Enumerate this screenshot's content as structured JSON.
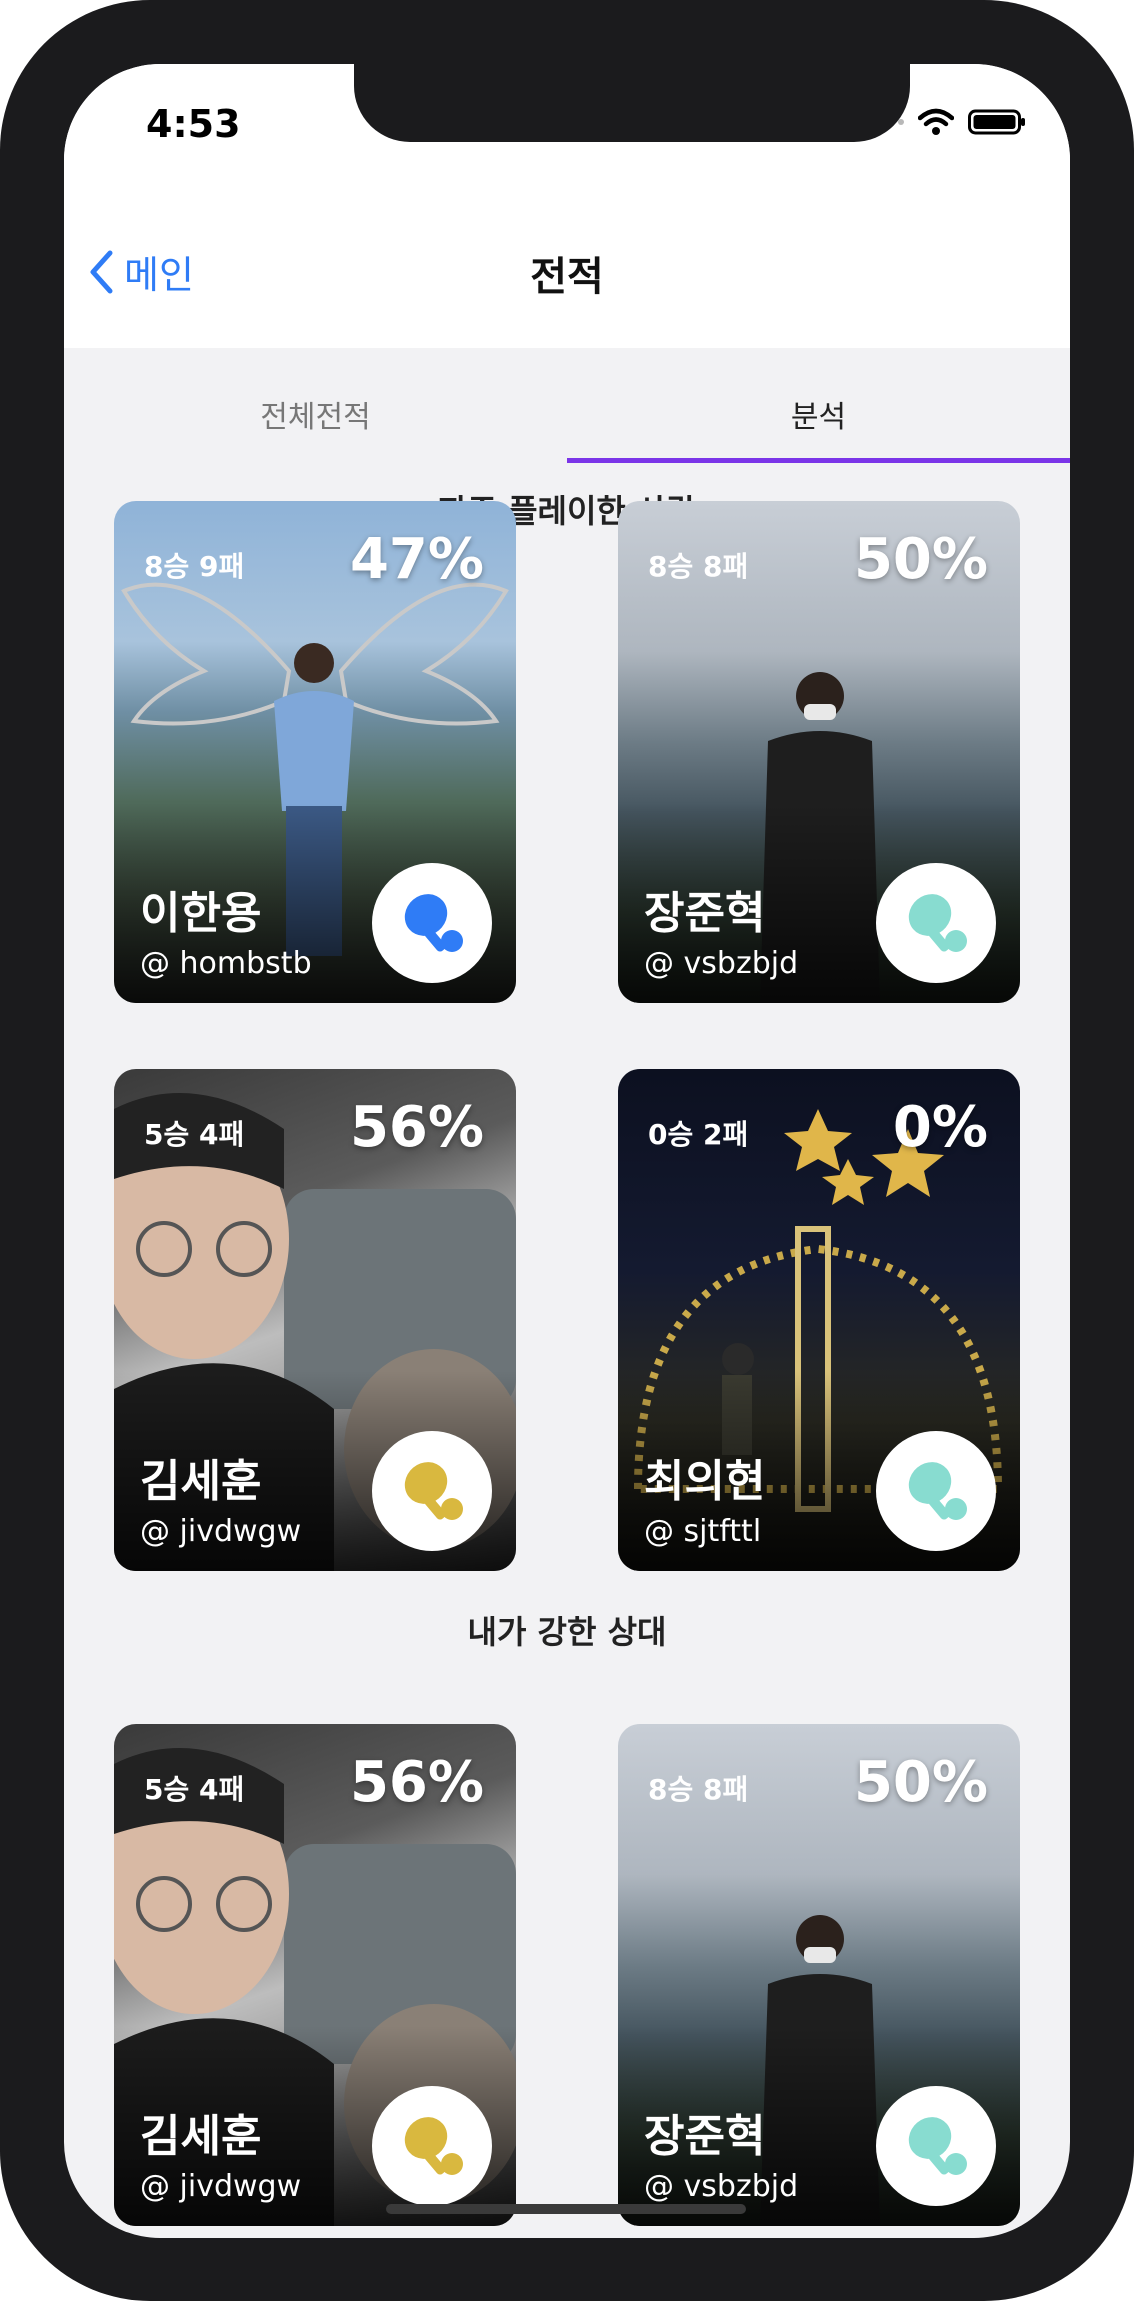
{
  "status": {
    "time": "4:53"
  },
  "nav": {
    "back_label": "메인",
    "title": "전적"
  },
  "tabs": [
    {
      "label": "전체전적"
    },
    {
      "label": "분석"
    }
  ],
  "sections": [
    {
      "title": "자주 플레이한 사람",
      "cards": [
        {
          "record": "8승 9패",
          "percent": "47%",
          "name": "이한용",
          "id": "@ hombstb",
          "badge_icon": "ping-pong-icon",
          "badge_color": "#2f7cf6"
        },
        {
          "record": "8승 8패",
          "percent": "50%",
          "name": "장준혁",
          "id": "@ vsbzbjd",
          "badge_icon": "ping-pong-icon",
          "badge_color": "#88dcd0"
        },
        {
          "record": "5승 4패",
          "percent": "56%",
          "name": "김세훈",
          "id": "@ jivdwgw",
          "badge_icon": "ping-pong-icon",
          "badge_color": "#d9b83f"
        },
        {
          "record": "0승 2패",
          "percent": "0%",
          "name": "최의현",
          "id": "@ sjtfttl",
          "badge_icon": "ping-pong-icon",
          "badge_color": "#88dcd0"
        }
      ]
    },
    {
      "title": "내가 강한 상대",
      "cards": [
        {
          "record": "5승 4패",
          "percent": "56%",
          "name": "김세훈",
          "id": "@ jivdwgw",
          "badge_icon": "ping-pong-icon",
          "badge_color": "#d9b83f"
        },
        {
          "record": "8승 8패",
          "percent": "50%",
          "name": "장준혁",
          "id": "@ vsbzbjd",
          "badge_icon": "ping-pong-icon",
          "badge_color": "#88dcd0"
        }
      ]
    }
  ],
  "colors": {
    "accent": "#7b35e8",
    "link": "#2f7cf6"
  }
}
